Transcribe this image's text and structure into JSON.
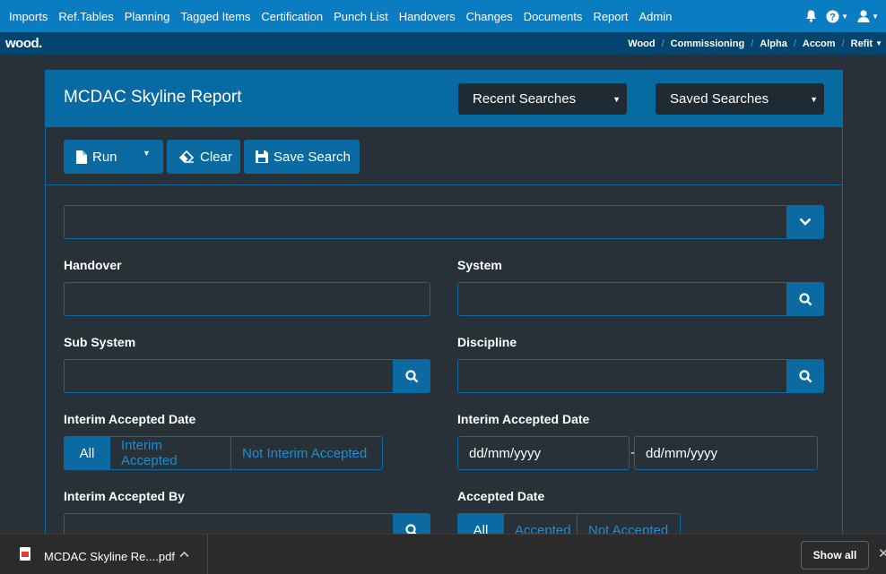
{
  "nav": {
    "items": [
      "Imports",
      "Ref.Tables",
      "Planning",
      "Tagged Items",
      "Certification",
      "Punch List",
      "Handovers",
      "Changes",
      "Documents",
      "Report",
      "Admin"
    ]
  },
  "brand": {
    "logo": "wood."
  },
  "breadcrumb": [
    "Wood",
    "Commissioning",
    "Alpha",
    "Accom",
    "Refit"
  ],
  "report": {
    "title": "MCDAC Skyline Report",
    "recent_searches": "Recent Searches",
    "saved_searches": "Saved Searches",
    "run_label": "Run",
    "clear_label": "Clear",
    "save_search_label": "Save Search"
  },
  "filters": {
    "handover_label": "Handover",
    "system_label": "System",
    "sub_system_label": "Sub System",
    "discipline_label": "Discipline",
    "interim_accepted_date_label": "Interim Accepted Date",
    "interim_accepted_date_label_2": "Interim Accepted Date",
    "interim_accepted_by_label": "Interim Accepted By",
    "accepted_date_label": "Accepted Date",
    "interim_options": [
      "All",
      "Interim Accepted",
      "Not Interim Accepted"
    ],
    "accepted_options": [
      "All",
      "Accepted",
      "Not Accepted"
    ],
    "date_from_placeholder": "dd/mm/yyyy",
    "date_to_placeholder": "dd/mm/yyyy",
    "date_separator": "-"
  },
  "downloads": {
    "file_name": "MCDAC Skyline Re....pdf",
    "show_all": "Show all",
    "close": "✕"
  },
  "colors": {
    "nav_bg": "#0a7dc2",
    "subbar_bg": "#03456e",
    "panel_header": "#076aa3",
    "accent": "#0a6aa1",
    "background": "#283138"
  }
}
